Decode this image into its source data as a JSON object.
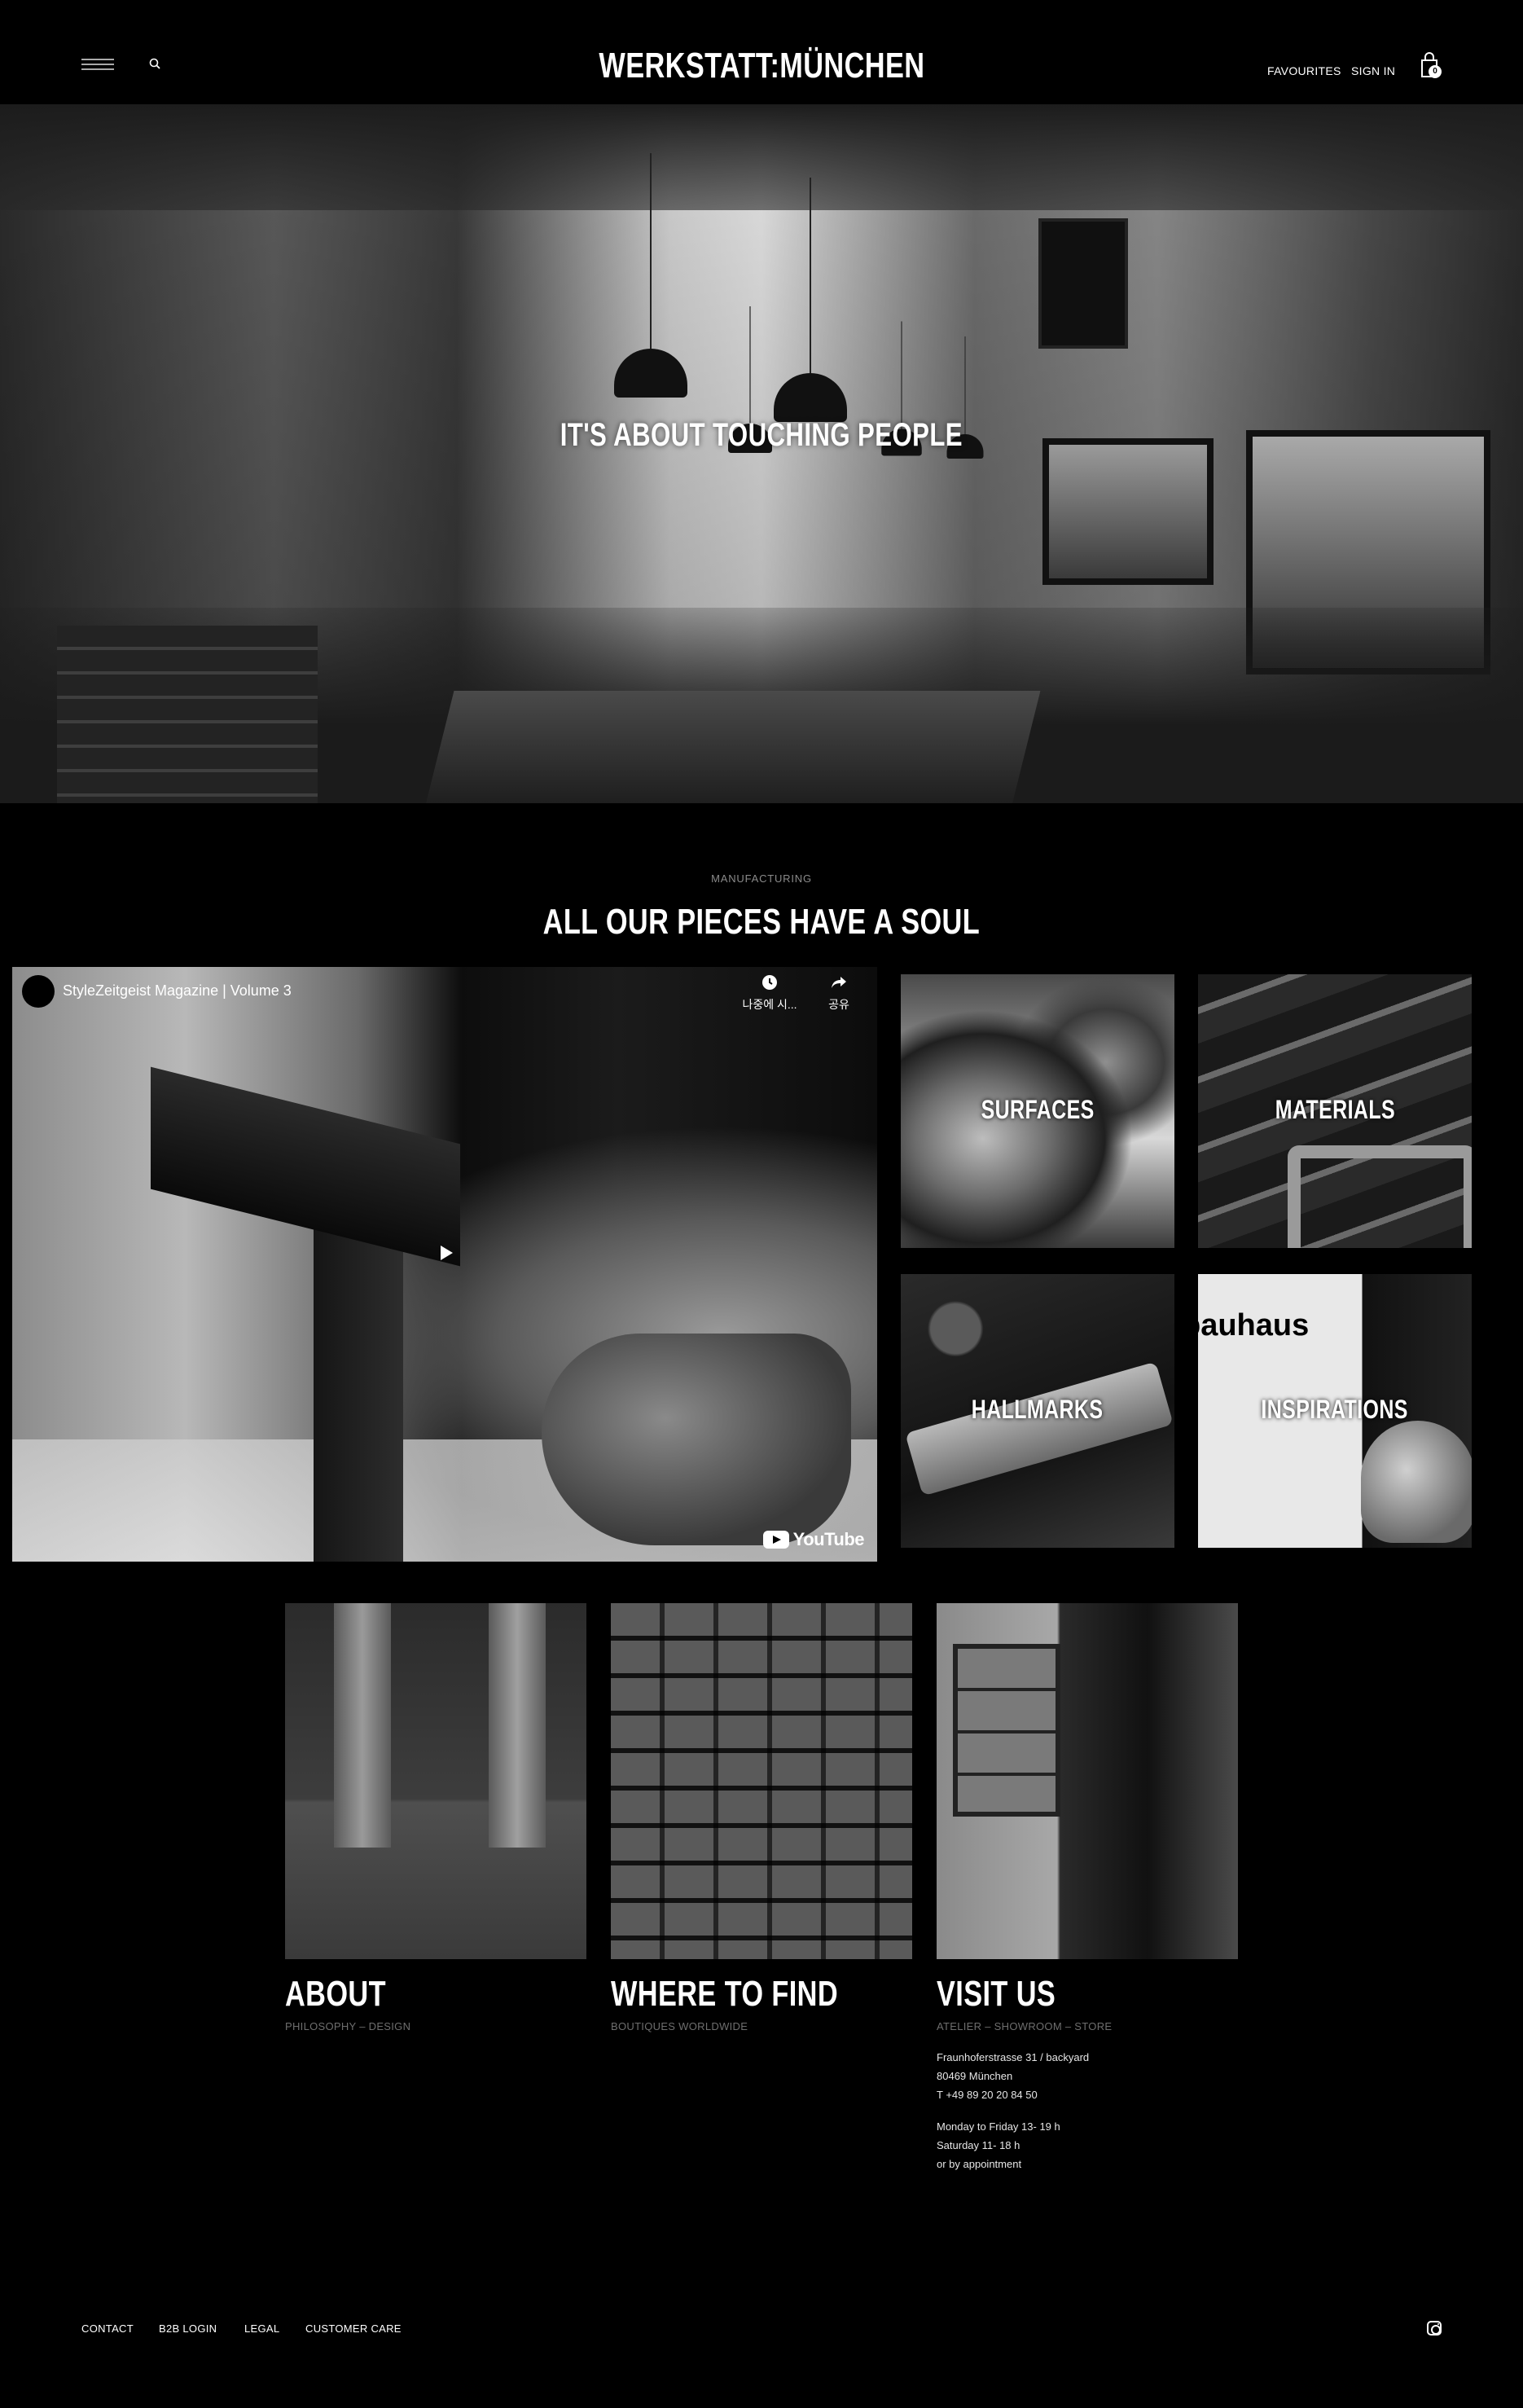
{
  "header": {
    "logo": "WERKSTATT:MÜNCHEN",
    "favourites": "FAVOURITES",
    "sign_in": "SIGN IN",
    "bag_count": "0"
  },
  "hero": {
    "title": "IT'S ABOUT TOUCHING PEOPLE"
  },
  "manufacturing": {
    "eyebrow": "MANUFACTURING",
    "title": "ALL OUR PIECES HAVE A SOUL",
    "video": {
      "title": "StyleZeitgeist Magazine | Volume 3",
      "watch_later": "나중에 시...",
      "share": "공유",
      "youtube": "YouTube"
    },
    "tiles": [
      {
        "label": "SURFACES"
      },
      {
        "label": "MATERIALS"
      },
      {
        "label": "HALLMARKS"
      },
      {
        "label": "INSPIRATIONS"
      }
    ],
    "tile_image_text": "bauhaus"
  },
  "cards": [
    {
      "title": "ABOUT",
      "subtitle": "PHILOSOPHY – DESIGN"
    },
    {
      "title": "WHERE TO FIND",
      "subtitle": "BOUTIQUES WORLDWIDE"
    },
    {
      "title": "VISIT US",
      "subtitle": "ATELIER – SHOWROOM – STORE"
    }
  ],
  "visit": {
    "address_line1": "Fraunhoferstrasse 31 / backyard",
    "address_line2": "80469 München",
    "phone": "T +49 89 20 20 84 50",
    "hours_line1": "Monday to Friday 13- 19 h",
    "hours_line2": "Saturday 11- 18 h",
    "hours_line3": "or by appointment"
  },
  "footer": {
    "links": [
      "CONTACT",
      "B2B LOGIN",
      "LEGAL",
      "CUSTOMER CARE"
    ]
  },
  "icons": {
    "menu": "hamburger-icon",
    "search": "search-icon",
    "bag": "shopping-bag-icon",
    "instagram": "instagram-icon",
    "play": "play-icon",
    "clock": "clock-icon",
    "share": "share-icon"
  }
}
